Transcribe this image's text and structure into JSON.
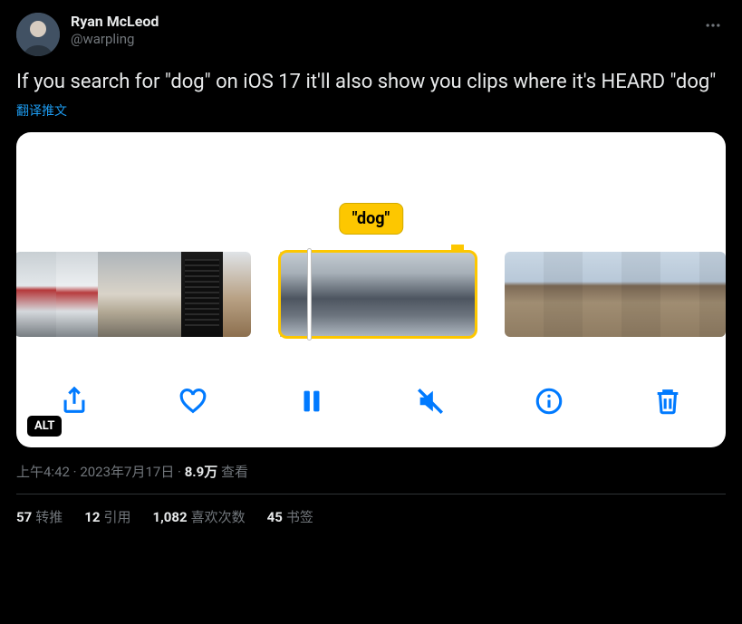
{
  "author": {
    "display_name": "Ryan McLeod",
    "handle": "@warpling"
  },
  "tweet_text": "If you search for \"dog\" on iOS 17 it'll also show you clips where it's HEARD \"dog\"",
  "translate_label": "翻译推文",
  "media": {
    "search_label": "\"dog\"",
    "alt_badge": "ALT",
    "toolbar_icons": {
      "share": "share-icon",
      "heart": "heart-icon",
      "pause": "pause-icon",
      "mute": "speaker-mute-icon",
      "info": "info-icon",
      "trash": "trash-icon"
    }
  },
  "meta": {
    "time": "上午4:42",
    "sep1": " · ",
    "date": "2023年7月17日",
    "sep2": " · ",
    "views_num": "8.9万",
    "views_label": " 查看"
  },
  "stats": {
    "retweets_num": "57",
    "retweets_label": "转推",
    "quotes_num": "12",
    "quotes_label": "引用",
    "likes_num": "1,082",
    "likes_label": "喜欢次数",
    "bookmarks_num": "45",
    "bookmarks_label": "书签"
  }
}
